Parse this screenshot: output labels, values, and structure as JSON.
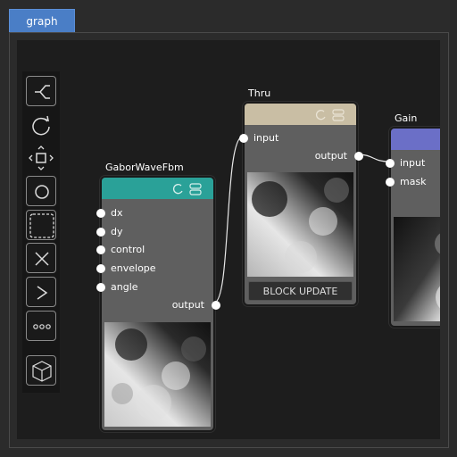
{
  "tab": {
    "label": "graph"
  },
  "colors": {
    "tab": "#4a7ec6",
    "gabor_head": "#2aa198",
    "thru_head": "#c9bea4",
    "gain_head": "#6b6fc7",
    "node_body": "#5f5f5f",
    "canvas": "#1d1d1d"
  },
  "toolbar": [
    {
      "icon": "branch-icon"
    },
    {
      "icon": "rotate-icon"
    },
    {
      "icon": "move-square-icon"
    },
    {
      "icon": "circle-icon"
    },
    {
      "icon": "dashed-square-icon"
    },
    {
      "icon": "cross-icon"
    },
    {
      "icon": "chevron-right-icon"
    },
    {
      "icon": "ellipsis-icon"
    },
    {
      "icon": "cube-icon"
    }
  ],
  "nodes": {
    "gabor": {
      "title": "GaborWaveFbm",
      "inputs": [
        "dx",
        "dy",
        "control",
        "envelope",
        "angle"
      ],
      "output": "output"
    },
    "thru": {
      "title": "Thru",
      "input": "input",
      "output": "output",
      "button": "BLOCK UPDATE"
    },
    "gain": {
      "title": "Gain",
      "inputs": [
        "input",
        "mask"
      ]
    }
  }
}
